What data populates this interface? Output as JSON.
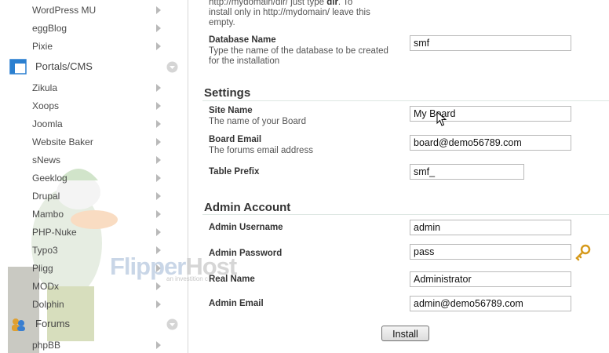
{
  "sidebar": {
    "items_top": [
      {
        "label": "WordPress MU"
      },
      {
        "label": "eggBlog"
      },
      {
        "label": "Pixie"
      }
    ],
    "category_portals": "Portals/CMS",
    "items_portals": [
      {
        "label": "Zikula"
      },
      {
        "label": "Xoops"
      },
      {
        "label": "Joomla"
      },
      {
        "label": "Website Baker"
      },
      {
        "label": "sNews"
      },
      {
        "label": "Geeklog"
      },
      {
        "label": "Drupal"
      },
      {
        "label": "Mambo"
      },
      {
        "label": "PHP-Nuke"
      },
      {
        "label": "Typo3"
      },
      {
        "label": "Pligg"
      },
      {
        "label": "MODx"
      },
      {
        "label": "Dolphin"
      }
    ],
    "category_forums": "Forums",
    "items_forums": [
      {
        "label": "phpBB"
      }
    ]
  },
  "watermark": {
    "brand_a": "Flipper",
    "brand_b": "Host",
    "sub": "an investition c"
  },
  "main": {
    "note_line1": "http://mydomain/dir/ just type",
    "note_bold": "dir",
    "note_line1_end": ". To",
    "note_line2": "install only in http://mydomain/ leave this",
    "note_line3": "empty.",
    "db_name": {
      "label": "Database Name",
      "desc": "Type the name of the database to be created for the installation",
      "value": "smf"
    },
    "settings_title": "Settings",
    "site_name": {
      "label": "Site Name",
      "desc": "The name of your Board",
      "value": "My Board"
    },
    "board_email": {
      "label": "Board Email",
      "desc": "The forums email address",
      "value": "board@demo56789.com"
    },
    "table_prefix": {
      "label": "Table Prefix",
      "value": "smf_"
    },
    "admin_title": "Admin Account",
    "admin_username": {
      "label": "Admin Username",
      "value": "admin"
    },
    "admin_password": {
      "label": "Admin Password",
      "value": "pass"
    },
    "real_name": {
      "label": "Real Name",
      "value": "Administrator"
    },
    "admin_email": {
      "label": "Admin Email",
      "value": "admin@demo56789.com"
    },
    "install_label": "Install"
  },
  "colors": {
    "accent": "#1e78c8",
    "arrow": "#b9b9b9",
    "section_line": "#dde7e2"
  },
  "icons": [
    "arrow-right-icon",
    "portals-cms-icon",
    "forums-icon",
    "chevron-down-icon",
    "key-icon",
    "mouse-cursor-icon"
  ]
}
